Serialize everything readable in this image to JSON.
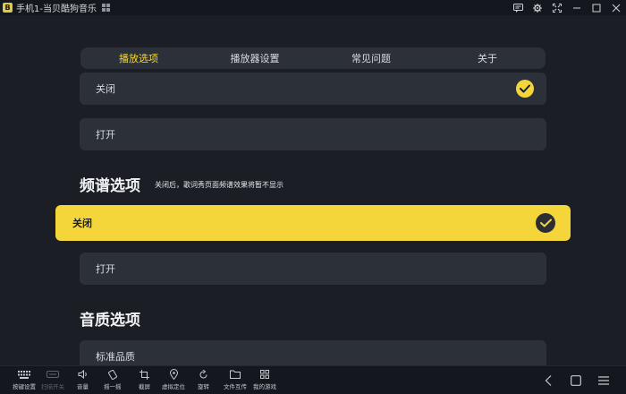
{
  "window": {
    "title": "手机1-当贝酷狗音乐",
    "app_icon_glyph": "B"
  },
  "tabs": [
    {
      "label": "播放选项",
      "active": true
    },
    {
      "label": "播放器设置",
      "active": false
    },
    {
      "label": "常见问题",
      "active": false
    },
    {
      "label": "关于",
      "active": false
    }
  ],
  "play_options": {
    "items": [
      {
        "label": "关闭",
        "selected": true
      },
      {
        "label": "打开",
        "selected": false
      }
    ]
  },
  "spectrum": {
    "title": "频谱选项",
    "hint": "关闭后，歌词秀页面频谱效果将暂不显示",
    "items": [
      {
        "label": "关闭",
        "selected": true
      },
      {
        "label": "打开",
        "selected": false
      }
    ]
  },
  "quality": {
    "title": "音质选项",
    "items": [
      {
        "label": "标准品质"
      }
    ]
  },
  "toolbar": {
    "items": [
      {
        "label": "按键设置",
        "icon": "keyboard-icon"
      },
      {
        "label": "扫描开关",
        "icon": "scan-icon",
        "disabled": true
      },
      {
        "label": "音量",
        "icon": "volume-icon"
      },
      {
        "label": "摇一摇",
        "icon": "shake-icon"
      },
      {
        "label": "截屏",
        "icon": "crop-icon"
      },
      {
        "label": "虚拟定位",
        "icon": "location-icon"
      },
      {
        "label": "旋转",
        "icon": "rotate-icon"
      },
      {
        "label": "文件互传",
        "icon": "folder-icon"
      },
      {
        "label": "我的游戏",
        "icon": "apps-icon"
      }
    ]
  },
  "colors": {
    "accent": "#f4d63a",
    "background": "#1b1e25",
    "row": "#2c3038",
    "bar": "#14171d"
  }
}
